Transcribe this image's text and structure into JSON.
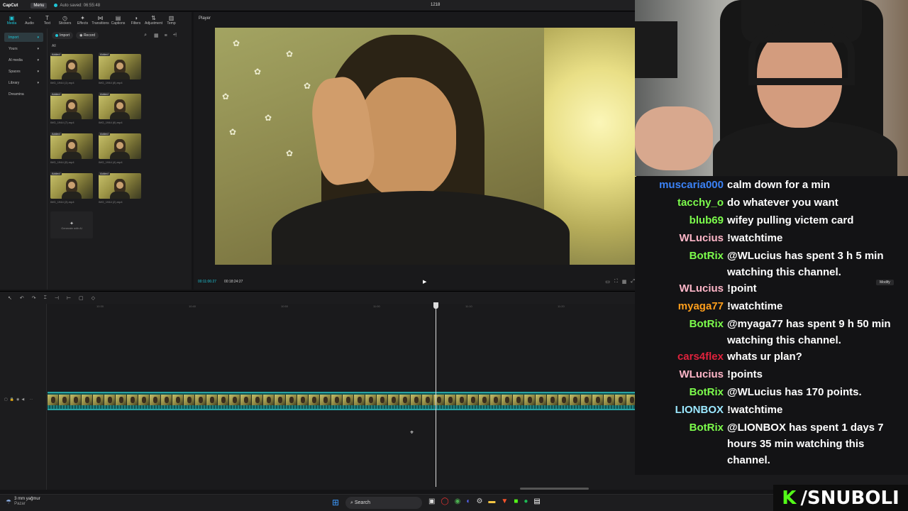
{
  "titlebar": {
    "logo": "CapCut",
    "menu": "Menu",
    "autosave": "Auto saved: 06:55:48",
    "project": "1218"
  },
  "toolbar": [
    {
      "label": "Media",
      "icon": "media-icon",
      "glyph": "▣",
      "active": true
    },
    {
      "label": "Audio",
      "icon": "audio-icon",
      "glyph": "◔"
    },
    {
      "label": "Text",
      "icon": "text-icon",
      "glyph": "T"
    },
    {
      "label": "Stickers",
      "icon": "sticker-icon",
      "glyph": "◷"
    },
    {
      "label": "Effects",
      "icon": "effects-icon",
      "glyph": "✦"
    },
    {
      "label": "Transitions",
      "icon": "transition-icon",
      "glyph": "⋈"
    },
    {
      "label": "Captions",
      "icon": "captions-icon",
      "glyph": "▤"
    },
    {
      "label": "Filters",
      "icon": "filters-icon",
      "glyph": "◑"
    },
    {
      "label": "Adjustment",
      "icon": "adjust-icon",
      "glyph": "⇅"
    },
    {
      "label": "Temp",
      "icon": "template-icon",
      "glyph": "▥"
    }
  ],
  "categories": [
    {
      "label": "Import",
      "active": true,
      "arrow": "▾"
    },
    {
      "label": "Yours",
      "arrow": "▾"
    },
    {
      "label": "AI media",
      "arrow": "▾"
    },
    {
      "label": "Spaces",
      "arrow": "▾"
    },
    {
      "label": "Library",
      "arrow": "▾"
    },
    {
      "label": "Dreamina",
      "arrow": ""
    }
  ],
  "media": {
    "import_label": "Import",
    "record_label": "Record",
    "all_label": "All",
    "added_badge": "Added",
    "files": [
      "IMG_1944 (1).mp4",
      "IMG_1944 (8).mp4",
      "IMG_1944 (7).mp4",
      "IMG_1944 (6).mp4",
      "IMG_1944 (5).mp4",
      "IMG_1944 (4).mp4",
      "IMG_1944 (3).mp4",
      "IMG_1944 (2).mp4"
    ],
    "generate_label": "Generate with AI"
  },
  "player": {
    "label": "Player",
    "current_time": "00:11:06:27",
    "total_time": "00:18:24:27"
  },
  "ruler": [
    "10:30",
    "10:40",
    "10:50",
    "11:00",
    "11:10",
    "11:20",
    "11:30",
    "11:40"
  ],
  "chat": [
    {
      "user": "muscaria000",
      "color": "#3b82f6",
      "text": "calm down for a min"
    },
    {
      "user": "tacchy_o",
      "color": "#7cfc4c",
      "text": "do whatever you want"
    },
    {
      "user": "blub69",
      "color": "#7cfc4c",
      "text": "wifey pulling victem card"
    },
    {
      "user": "WLucius",
      "color": "#ffb6c8",
      "text": "!watchtime"
    },
    {
      "user": "BotRix",
      "color": "#7cfc4c",
      "text": "@WLucius has spent 3 h 5 min watching this channel."
    },
    {
      "user": "WLucius",
      "color": "#ffb6c8",
      "text": "!point"
    },
    {
      "user": "myaga77",
      "color": "#ff9f1c",
      "text": "!watchtime"
    },
    {
      "user": "BotRix",
      "color": "#7cfc4c",
      "text": "@myaga77 has spent 9 h 50 min watching this channel."
    },
    {
      "user": "cars4flex",
      "color": "#e0223c",
      "text": "whats ur plan?"
    },
    {
      "user": "WLucius",
      "color": "#ffb6c8",
      "text": "!points"
    },
    {
      "user": "BotRix",
      "color": "#7cfc4c",
      "text": "@WLucius has 170 points."
    },
    {
      "user": "LIONBOX",
      "color": "#9be8ff",
      "text": "!watchtime"
    },
    {
      "user": "BotRix",
      "color": "#7cfc4c",
      "text": "@LIONBOX has spent 1 days 7 hours 35 min watching this channel."
    }
  ],
  "modify_label": "Modify",
  "brand": {
    "logo": "K",
    "handle": "/SNUBOLI"
  },
  "taskbar": {
    "weather_temp": "3 mm yağmur",
    "weather_day": "Pazar",
    "search": "Search"
  }
}
